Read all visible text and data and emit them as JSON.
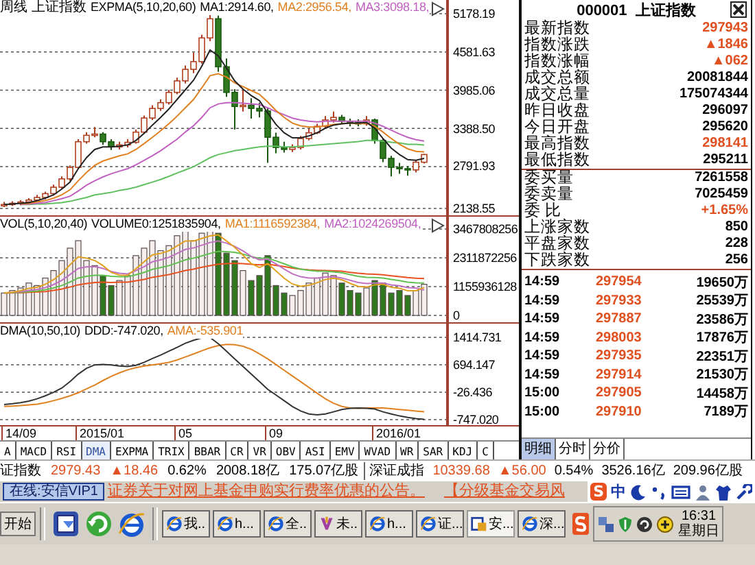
{
  "price_pane": {
    "period": "周线",
    "name": "上证指数",
    "indicator": "EXPMA(5,10,20,60)",
    "items": [
      {
        "text": "MA1:2914.60,",
        "color": "#000000"
      },
      {
        "text": "MA2:2956.54,",
        "color": "#e08020"
      },
      {
        "text": "MA3:3098.18,",
        "color": "#c060c0"
      }
    ],
    "chart_data": {
      "type": "candlestick",
      "grid": true,
      "ylim": [
        2138.55,
        5178.19
      ],
      "ohlc": [
        [
          2190,
          2240,
          2160,
          2200
        ],
        [
          2200,
          2250,
          2180,
          2220
        ],
        [
          2220,
          2270,
          2190,
          2240
        ],
        [
          2240,
          2300,
          2210,
          2270
        ],
        [
          2270,
          2350,
          2240,
          2310
        ],
        [
          2310,
          2400,
          2280,
          2370
        ],
        [
          2370,
          2510,
          2340,
          2470
        ],
        [
          2470,
          2640,
          2440,
          2600
        ],
        [
          2600,
          2810,
          2570,
          2780
        ],
        [
          2780,
          3220,
          2760,
          3180
        ],
        [
          3180,
          3330,
          3150,
          3280
        ],
        [
          3280,
          3410,
          3250,
          3300
        ],
        [
          3300,
          3330,
          3130,
          3180
        ],
        [
          3180,
          3220,
          3050,
          3100
        ],
        [
          3100,
          3180,
          3060,
          3130
        ],
        [
          3130,
          3220,
          3090,
          3170
        ],
        [
          3170,
          3370,
          3150,
          3330
        ],
        [
          3330,
          3590,
          3310,
          3550
        ],
        [
          3550,
          3750,
          3520,
          3700
        ],
        [
          3700,
          3840,
          3660,
          3790
        ],
        [
          3790,
          3990,
          3760,
          3950
        ],
        [
          3950,
          4180,
          3920,
          4130
        ],
        [
          4130,
          4370,
          4090,
          4310
        ],
        [
          4310,
          4570,
          4250,
          4430
        ],
        [
          4430,
          4850,
          4400,
          4800
        ],
        [
          4800,
          5170,
          4750,
          5100
        ],
        [
          5100,
          5150,
          4270,
          4350
        ],
        [
          4350,
          4480,
          3880,
          3950
        ],
        [
          3950,
          4000,
          3370,
          3730
        ],
        [
          3730,
          3990,
          3650,
          3750
        ],
        [
          3750,
          3860,
          3540,
          3700
        ],
        [
          3700,
          3790,
          3560,
          3660
        ],
        [
          3660,
          3700,
          2850,
          3250
        ],
        [
          3250,
          3320,
          3000,
          3090
        ],
        [
          3090,
          3180,
          3010,
          3060
        ],
        [
          3060,
          3140,
          3020,
          3090
        ],
        [
          3090,
          3270,
          3060,
          3230
        ],
        [
          3230,
          3380,
          3200,
          3320
        ],
        [
          3320,
          3460,
          3300,
          3420
        ],
        [
          3420,
          3580,
          3400,
          3520
        ],
        [
          3520,
          3650,
          3480,
          3560
        ],
        [
          3560,
          3600,
          3460,
          3500
        ],
        [
          3500,
          3540,
          3420,
          3480
        ],
        [
          3480,
          3530,
          3420,
          3460
        ],
        [
          3460,
          3580,
          3430,
          3520
        ],
        [
          3520,
          3540,
          3150,
          3200
        ],
        [
          3200,
          3230,
          2860,
          2920
        ],
        [
          2920,
          2960,
          2640,
          2780
        ],
        [
          2780,
          2850,
          2680,
          2760
        ],
        [
          2760,
          2800,
          2650,
          2740
        ],
        [
          2740,
          2890,
          2700,
          2860
        ],
        [
          2860,
          2990,
          2840,
          2980
        ]
      ],
      "yticks": [
        {
          "value": 5178.19,
          "label": "5178.19"
        },
        {
          "value": 4581.63,
          "label": "4581.63"
        },
        {
          "value": 3985.06,
          "label": "3985.06"
        },
        {
          "value": 3388.5,
          "label": "3388.50"
        },
        {
          "value": 2791.93,
          "label": "2791.93"
        },
        {
          "value": 2138.55,
          "label": "2138.55"
        }
      ],
      "series": [
        {
          "type": "line",
          "color": "#60c060",
          "values": [
            null,
            null,
            2200,
            2200,
            2210,
            2210,
            2220,
            2230,
            2250,
            2280,
            2310,
            2350,
            2370,
            2390,
            2420,
            2440,
            2470,
            2510,
            2550,
            2590,
            2640,
            2690,
            2740,
            2790,
            2860,
            2930,
            2980,
            3010,
            3040,
            3060,
            3080,
            3100,
            3110,
            3110,
            3100,
            3100,
            3110,
            3120,
            3130,
            3140,
            3150,
            3160,
            3170,
            3180,
            3200,
            3200,
            3190,
            3170,
            3160,
            3140,
            3140,
            3130
          ]
        },
        {
          "type": "line",
          "color": "#c060c0",
          "values": [
            null,
            null,
            2200,
            2210,
            2220,
            2230,
            2260,
            2290,
            2330,
            2410,
            2500,
            2570,
            2630,
            2680,
            2720,
            2760,
            2820,
            2890,
            2960,
            3040,
            3130,
            3220,
            3330,
            3430,
            3560,
            3710,
            3770,
            3790,
            3790,
            3780,
            3770,
            3760,
            3710,
            3650,
            3600,
            3550,
            3520,
            3500,
            3490,
            3500,
            3500,
            3500,
            3500,
            3500,
            3500,
            3470,
            3420,
            3360,
            3300,
            3250,
            3210,
            3190
          ]
        },
        {
          "type": "line",
          "color": "#e08020",
          "values": [
            null,
            null,
            2210,
            2220,
            2240,
            2260,
            2300,
            2350,
            2430,
            2570,
            2700,
            2810,
            2880,
            2920,
            2960,
            2990,
            3060,
            3150,
            3250,
            3350,
            3460,
            3580,
            3710,
            3840,
            4020,
            4210,
            4240,
            4190,
            4100,
            4040,
            3980,
            3920,
            3800,
            3670,
            3560,
            3470,
            3430,
            3410,
            3410,
            3430,
            3450,
            3460,
            3470,
            3460,
            3470,
            3420,
            3330,
            3230,
            3140,
            3070,
            3030,
            3020
          ]
        },
        {
          "type": "line",
          "color": "#222222",
          "values": [
            2200,
            2210,
            2220,
            2230,
            2260,
            2300,
            2350,
            2440,
            2550,
            2760,
            2930,
            3060,
            3100,
            3100,
            3110,
            3130,
            3200,
            3310,
            3440,
            3560,
            3690,
            3840,
            3990,
            4140,
            4360,
            4610,
            4520,
            4330,
            4130,
            4000,
            3900,
            3820,
            3630,
            3450,
            3320,
            3240,
            3240,
            3270,
            3320,
            3390,
            3440,
            3460,
            3470,
            3470,
            3480,
            3390,
            3230,
            3080,
            2980,
            2900,
            2890,
            2920
          ]
        }
      ]
    }
  },
  "volume_pane": {
    "indicator": "VOL(5,10,20,40)",
    "items": [
      {
        "text": "VOLUME0:1251835904,",
        "color": "#000000"
      },
      {
        "text": "MA1:1116592384,",
        "color": "#e08020"
      },
      {
        "text": "MA2:1024269504,",
        "color": "#c060c0"
      }
    ],
    "chart_data": {
      "type": "bar",
      "grid": true,
      "ylim": [
        0,
        3467808256
      ],
      "yticks": [
        {
          "value": 3467808256,
          "label": "3467808256"
        },
        {
          "value": 2311872256,
          "label": "2311872256"
        },
        {
          "value": 1155936128,
          "label": "1155936128"
        },
        {
          "value": 0,
          "label": "0"
        }
      ],
      "series": [
        {
          "colors": [
            "#f4eeee",
            "#f4eeee",
            "#f4eeee",
            "#f4eeee",
            "#f4eeee",
            "#f4eeee",
            "#f4eeee",
            "#f4eeee",
            "#f4eeee",
            "#f4eeee",
            "#f4eeee",
            "#f4eeee",
            "#2f7a1f",
            "#2f7a1f",
            "#f4eeee",
            "#f4eeee",
            "#f4eeee",
            "#f4eeee",
            "#f4eeee",
            "#f4eeee",
            "#f4eeee",
            "#f4eeee",
            "#f4eeee",
            "#f4eeee",
            "#f4eeee",
            "#f4eeee",
            "#2f7a1f",
            "#2f7a1f",
            "#2f7a1f",
            "#f4eeee",
            "#2f7a1f",
            "#2f7a1f",
            "#2f7a1f",
            "#2f7a1f",
            "#2f7a1f",
            "#f4eeee",
            "#f4eeee",
            "#f4eeee",
            "#f4eeee",
            "#f4eeee",
            "#f4eeee",
            "#2f7a1f",
            "#2f7a1f",
            "#2f7a1f",
            "#f4eeee",
            "#2f7a1f",
            "#2f7a1f",
            "#2f7a1f",
            "#2f7a1f",
            "#2f7a1f",
            "#f4eeee",
            "#f4eeee"
          ],
          "values": [
            900000000.0,
            1000000000.0,
            1100000000.0,
            1300000000.0,
            1200000000.0,
            1500000000.0,
            1800000000.0,
            2200000000.0,
            2700000000.0,
            3000000000.0,
            2200000000.0,
            2000000000.0,
            1600000000.0,
            1200000000.0,
            1400000000.0,
            1600000000.0,
            2400000000.0,
            2700000000.0,
            3000000000.0,
            2600000000.0,
            2800000000.0,
            3200000000.0,
            3400000000.0,
            3000000000.0,
            3300000000.0,
            3400000000.0,
            3300000000.0,
            2500000000.0,
            2200000000.0,
            1800000000.0,
            1400000000.0,
            1600000000.0,
            2400000000.0,
            1200000000.0,
            900000000.0,
            800000000.0,
            1000000000.0,
            1300000000.0,
            1500000000.0,
            1700000000.0,
            1600000000.0,
            1300000000.0,
            1000000000.0,
            900000000.0,
            1100000000.0,
            1400000000.0,
            1300000000.0,
            900000000.0,
            1000000000.0,
            800000000.0,
            1000000000.0,
            1250000000.0
          ]
        },
        {
          "type": "line",
          "color": "#e85020",
          "values": [
            900000000.0,
            900000000.0,
            910000000.0,
            930000000.0,
            940000000.0,
            960000000.0,
            1000000000.0,
            1060000000.0,
            1140000000.0,
            1230000000.0,
            1280000000.0,
            1320000000.0,
            1330000000.0,
            1320000000.0,
            1330000000.0,
            1340000000.0,
            1390000000.0,
            1450000000.0,
            1530000000.0,
            1580000000.0,
            1640000000.0,
            1720000000.0,
            1800000000.0,
            1860000000.0,
            1930000000.0,
            2000000000.0,
            2060000000.0,
            2080000000.0,
            2090000000.0,
            2080000000.0,
            2050000000.0,
            2030000000.0,
            2050000000.0,
            2010000000.0,
            1960000000.0,
            1900000000.0,
            1860000000.0,
            1830000000.0,
            1810000000.0,
            1800000000.0,
            1790000000.0,
            1770000000.0,
            1730000000.0,
            1690000000.0,
            1660000000.0,
            1650000000.0,
            1630000000.0,
            1590000000.0,
            1560000000.0,
            1520000000.0,
            1490000000.0,
            1480000000.0
          ]
        },
        {
          "type": "line",
          "color": "#60c050",
          "values": [
            900000000.0,
            910000000.0,
            930000000.0,
            960000000.0,
            980000000.0,
            1030000000.0,
            1100000000.0,
            1200000000.0,
            1340000000.0,
            1500000000.0,
            1570000000.0,
            1610000000.0,
            1610000000.0,
            1570000000.0,
            1550000000.0,
            1550000000.0,
            1630000000.0,
            1730000000.0,
            1850000000.0,
            1920000000.0,
            2000000000.0,
            2110000000.0,
            2230000000.0,
            2300000000.0,
            2390000000.0,
            2490000000.0,
            2570000000.0,
            2560000000.0,
            2530000000.0,
            2460000000.0,
            2360000000.0,
            2290000000.0,
            2300000000.0,
            2190000000.0,
            2070000000.0,
            1950000000.0,
            1860000000.0,
            1810000000.0,
            1780000000.0,
            1770000000.0,
            1750000000.0,
            1710000000.0,
            1640000000.0,
            1570000000.0,
            1530000000.0,
            1520000000.0,
            1500000000.0,
            1440000000.0,
            1400000000.0,
            1340000000.0,
            1310000000.0,
            1300000000.0
          ]
        },
        {
          "type": "line",
          "color": "#c070c0",
          "values": [
            900000000.0,
            920000000.0,
            950000000.0,
            1010000000.0,
            1040000000.0,
            1120000000.0,
            1240000000.0,
            1410000000.0,
            1640000000.0,
            1890000000.0,
            1950000000.0,
            1960000000.0,
            1890000000.0,
            1760000000.0,
            1690000000.0,
            1670000000.0,
            1800000000.0,
            1960000000.0,
            2150000000.0,
            2230000000.0,
            2330000000.0,
            2490000000.0,
            2650000000.0,
            2710000000.0,
            2820000000.0,
            2930000000.0,
            2990000000.0,
            2900000000.0,
            2770000000.0,
            2590000000.0,
            2370000000.0,
            2230000000.0,
            2260000000.0,
            2070000000.0,
            1860000000.0,
            1670000000.0,
            1550000000.0,
            1500000000.0,
            1500000000.0,
            1540000000.0,
            1550000000.0,
            1500000000.0,
            1410000000.0,
            1320000000.0,
            1280000000.0,
            1300000000.0,
            1300000000.0,
            1230000000.0,
            1190000000.0,
            1120000000.0,
            1100000000.0,
            1020000000.0
          ]
        },
        {
          "type": "line",
          "color": "#e0a020",
          "values": [
            900000000.0,
            930000000.0,
            990000000.0,
            1090000000.0,
            1130000000.0,
            1250000000.0,
            1430000000.0,
            1690000000.0,
            2030000000.0,
            2350000000.0,
            2300000000.0,
            2200000000.0,
            2000000000.0,
            1730000000.0,
            1620000000.0,
            1610000000.0,
            1870000000.0,
            2150000000.0,
            2430000000.0,
            2490000000.0,
            2590000000.0,
            2790000000.0,
            2990000000.0,
            2990000000.0,
            3090000000.0,
            3190000000.0,
            3230000000.0,
            2990000000.0,
            2730000000.0,
            2420000000.0,
            2080000000.0,
            1920000000.0,
            2080000000.0,
            1790000000.0,
            1490000000.0,
            1260000000.0,
            1170000000.0,
            1210000000.0,
            1310000000.0,
            1440000000.0,
            1490000000.0,
            1430000000.0,
            1290000000.0,
            1160000000.0,
            1140000000.0,
            1230000000.0,
            1250000000.0,
            1130000000.0,
            1090000000.0,
            990000000.0,
            990000000.0,
            1120000000.0
          ]
        }
      ]
    }
  },
  "dma_pane": {
    "indicator": "DMA(10,50,10)",
    "items": [
      {
        "text": "DDD:-747.020,",
        "color": "#000000"
      },
      {
        "text": "AMA:-535.901",
        "color": "#e08020"
      }
    ],
    "chart_data": {
      "type": "line",
      "grid": true,
      "ylim": [
        -747.02,
        1414.731
      ],
      "yticks": [
        {
          "value": 1414.731,
          "label": "1414.731"
        },
        {
          "value": 694.147,
          "label": "694.147"
        },
        {
          "value": -26.436,
          "label": "-26.436"
        },
        {
          "value": -747.02,
          "label": "-747.020"
        }
      ],
      "series": [
        {
          "color": "#e08020",
          "values": [
            -400,
            -390,
            -380,
            -360,
            -340,
            -300,
            -250,
            -190,
            -120,
            -40,
            60,
            160,
            280,
            390,
            480,
            560,
            620,
            660,
            690,
            720,
            760,
            820,
            900,
            980,
            1060,
            1140,
            1200,
            1230,
            1220,
            1180,
            1100,
            980,
            850,
            700,
            550,
            400,
            250,
            100,
            -50,
            -200,
            -320,
            -400,
            -440,
            -450,
            -440,
            -440,
            -440,
            -460,
            -480,
            -500,
            -520,
            -540
          ]
        },
        {
          "color": "#333333",
          "values": [
            -350,
            -330,
            -300,
            -260,
            -200,
            -120,
            -30,
            80,
            250,
            450,
            600,
            690,
            700,
            690,
            660,
            650,
            680,
            760,
            860,
            950,
            1050,
            1150,
            1260,
            1340,
            1400,
            1410,
            1250,
            1050,
            850,
            650,
            450,
            250,
            50,
            -100,
            -250,
            -400,
            -520,
            -600,
            -620,
            -600,
            -540,
            -480,
            -450,
            -440,
            -450,
            -470,
            -540,
            -600,
            -650,
            -690,
            -720,
            -740
          ]
        }
      ]
    }
  },
  "date_axis": [
    "14/09",
    "2015/01",
    "05",
    "09",
    "2016/01"
  ],
  "indicator_tabs": [
    {
      "label": "A",
      "selected": false
    },
    {
      "label": "MACD",
      "selected": false
    },
    {
      "label": "RSI",
      "selected": false
    },
    {
      "label": "DMA",
      "selected": true
    },
    {
      "label": "EXPMA",
      "selected": false
    },
    {
      "label": "TRIX",
      "selected": false
    },
    {
      "label": "BBAR",
      "selected": false
    },
    {
      "label": "CR",
      "selected": false
    },
    {
      "label": "VR",
      "selected": false
    },
    {
      "label": "OBV",
      "selected": false
    },
    {
      "label": "ASI",
      "selected": false
    },
    {
      "label": "EMV",
      "selected": false
    },
    {
      "label": "WVAD",
      "selected": false
    },
    {
      "label": "WR",
      "selected": false
    },
    {
      "label": "SAR",
      "selected": false
    },
    {
      "label": "KDJ",
      "selected": false
    },
    {
      "label": "C",
      "selected": false
    }
  ],
  "quote": {
    "title": "000001  上证指数",
    "rows": [
      {
        "label": "最新指数",
        "value": "297943",
        "color": "#e05020"
      },
      {
        "label": "指数涨跌",
        "value": "▲1846",
        "color": "#e05020"
      },
      {
        "label": "指数涨幅",
        "value": "▲062",
        "color": "#e05020"
      },
      {
        "label": "成交总额",
        "value": "20081844",
        "color": "#000000"
      },
      {
        "label": "成交总量",
        "value": "175074344",
        "color": "#000000"
      },
      {
        "label": "昨日收盘",
        "value": "296097",
        "color": "#000000"
      },
      {
        "label": "今日开盘",
        "value": "295620",
        "color": "#000000"
      },
      {
        "label": "最高指数",
        "value": "298141",
        "color": "#e05020"
      },
      {
        "label": "最低指数",
        "value": "295211",
        "color": "#000000"
      }
    ],
    "orders": [
      {
        "label": "委买量",
        "value": "7261558",
        "color": "#000000"
      },
      {
        "label": "委卖量",
        "value": "7025459",
        "color": "#000000"
      },
      {
        "label": "委 比",
        "value": "+1.65%",
        "color": "#e05020"
      },
      {
        "label": "上涨家数",
        "value": "850",
        "color": "#000000"
      },
      {
        "label": "平盘家数",
        "value": "228",
        "color": "#000000"
      },
      {
        "label": "下跌家数",
        "value": "256",
        "color": "#000000"
      }
    ],
    "ticks": [
      {
        "time": "14:59",
        "price": "297954",
        "volume": "19650万"
      },
      {
        "time": "14:59",
        "price": "297933",
        "volume": "25539万"
      },
      {
        "time": "14:59",
        "price": "297887",
        "volume": "23586万"
      },
      {
        "time": "14:59",
        "price": "298003",
        "volume": "17876万"
      },
      {
        "time": "14:59",
        "price": "297935",
        "volume": "22351万"
      },
      {
        "time": "14:59",
        "price": "297914",
        "volume": "21530万"
      },
      {
        "time": "15:00",
        "price": "297905",
        "volume": "14458万"
      },
      {
        "time": "15:00",
        "price": "297910",
        "volume": "7189万"
      }
    ],
    "tabs": [
      {
        "label": "明细",
        "selected": true
      },
      {
        "label": "分时",
        "selected": false
      },
      {
        "label": "分价",
        "selected": false
      }
    ]
  },
  "ticker": [
    {
      "name": "证指数",
      "value": "2979.43",
      "change": "▲18.46",
      "percent": "0.62%",
      "amount": "2008.18亿",
      "volume": "175.07亿股"
    },
    {
      "name": "深证成指",
      "value": "10339.68",
      "change": "▲56.00",
      "percent": "0.54%",
      "amount": "3526.16亿",
      "volume": "209.96亿股"
    }
  ],
  "news_bar": {
    "status": "在线:安信VIP1",
    "headlines": [
      "证券关于对网上基金申购实行费率优惠的公告。",
      "【分级基金交易风"
    ],
    "ime_logo": "S",
    "ime_mode": "中"
  },
  "taskbar": {
    "start": "开始",
    "tasks": [
      {
        "label": "我..",
        "kind": "browser",
        "selected": false
      },
      {
        "label": "h...",
        "kind": "browser",
        "selected": false
      },
      {
        "label": "全..",
        "kind": "browser",
        "selected": false
      },
      {
        "label": "未..",
        "kind": "document",
        "selected": false
      },
      {
        "label": "h...",
        "kind": "browser",
        "selected": false
      },
      {
        "label": "证...",
        "kind": "browser",
        "selected": false
      },
      {
        "label": "安...",
        "kind": "app",
        "selected": true
      },
      {
        "label": "深...",
        "kind": "browser",
        "selected": false
      }
    ],
    "time": "16:31",
    "day": "星期日"
  }
}
